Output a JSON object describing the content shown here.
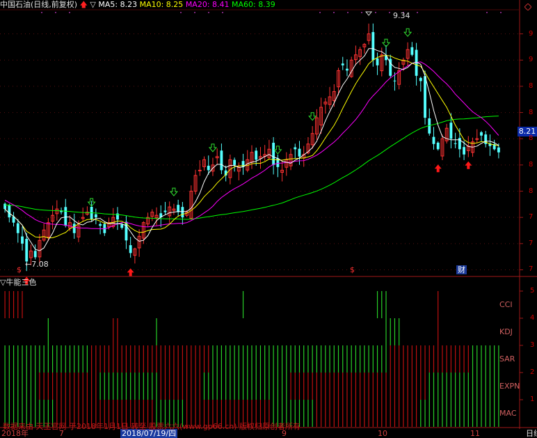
{
  "header": {
    "title": "中国石油(日线,前复权)",
    "ma5_label": "MA5: 8.23",
    "ma10_label": "MA10: 8.25",
    "ma20_label": "MA20: 8.41",
    "ma60_label": "MA60: 8.39",
    "colors": {
      "title": "#e0e0e0",
      "ma5": "#ffffff",
      "ma10": "#ffff00",
      "ma20": "#ff00ff",
      "ma60": "#00ff00"
    }
  },
  "price_panel": {
    "y_ticks": [
      "9",
      "9",
      "8",
      "8",
      "8",
      "8",
      "8",
      "7",
      "7",
      "7",
      "7"
    ],
    "current_price": "8.21",
    "high_annotation": "9.34",
    "low_annotation": "←7.08",
    "event_markers": [
      "$",
      "$",
      "财"
    ]
  },
  "indicator_panel": {
    "title": "牛能三色",
    "row_labels": [
      "CCI",
      "KDJ",
      "SAR",
      "EXPN",
      "MAC"
    ],
    "y_ticks": [
      "5",
      "4",
      "3",
      "2",
      "1"
    ]
  },
  "x_axis": {
    "labels": [
      "2018年",
      "7",
      "2018/07/19/四",
      "9",
      "10",
      "11"
    ],
    "selected_date": "2018/07/19/四",
    "watermark": "数据来由 天王官网 于2018年1月1日 转至 股票六六(www.gp66.cn) 版权归原创者所有",
    "corner_label": "日线"
  },
  "chart_data": {
    "type": "candlestick",
    "ylim": [
      6.95,
      9.48
    ],
    "y_tick_values": [
      9.25,
      9.0,
      8.75,
      8.5,
      8.25,
      8.0,
      7.75,
      7.5,
      7.25,
      7.0
    ],
    "up_color": "#ff3232",
    "down_color": "#54ffff",
    "ma_colors": {
      "ma5": "#ffffff",
      "ma10": "#ffff00",
      "ma20": "#ff00ff",
      "ma60": "#00ff00"
    },
    "closes": [
      7.58,
      7.5,
      7.45,
      7.35,
      7.25,
      7.08,
      7.18,
      7.12,
      7.28,
      7.38,
      7.45,
      7.52,
      7.58,
      7.55,
      7.42,
      7.45,
      7.35,
      7.42,
      7.5,
      7.55,
      7.48,
      7.5,
      7.42,
      7.35,
      7.45,
      7.5,
      7.48,
      7.4,
      7.28,
      7.16,
      7.2,
      7.32,
      7.45,
      7.5,
      7.55,
      7.52,
      7.5,
      7.55,
      7.6,
      7.58,
      7.55,
      7.5,
      7.55,
      7.75,
      7.9,
      7.95,
      8.05,
      7.95,
      8.0,
      8.08,
      7.95,
      7.9,
      8.05,
      8.0,
      7.98,
      7.98,
      8.05,
      8.12,
      8.05,
      8.08,
      8.1,
      8.15,
      8.0,
      7.98,
      7.95,
      8.05,
      8.1,
      8.15,
      8.08,
      8.1,
      8.2,
      8.3,
      8.45,
      8.55,
      8.6,
      8.65,
      8.7,
      8.9,
      8.95,
      8.9,
      9.0,
      9.05,
      9.1,
      9.15,
      9.25,
      9.0,
      8.95,
      9.05,
      9.0,
      8.85,
      8.8,
      8.9,
      9.0,
      9.1,
      9.05,
      8.85,
      8.8,
      8.45,
      8.3,
      8.2,
      8.15,
      8.25,
      8.35,
      8.25,
      8.2,
      8.15,
      8.1,
      8.18,
      8.22,
      8.25,
      8.28,
      8.2,
      8.18,
      8.15,
      8.12
    ],
    "bottom_rows": [
      {
        "name": "CCI",
        "segments": [
          [
            0,
            "r"
          ],
          [
            5,
            "n"
          ],
          [
            55,
            "g"
          ],
          [
            56,
            "n"
          ],
          [
            86,
            "g"
          ],
          [
            89,
            "n"
          ],
          [
            100,
            "r"
          ],
          [
            101,
            "n"
          ]
        ]
      },
      {
        "name": "KDJ",
        "segments": [
          [
            0,
            "n"
          ],
          [
            10,
            "g"
          ],
          [
            11,
            "n"
          ],
          [
            25,
            "r"
          ],
          [
            27,
            "n"
          ],
          [
            35,
            "g"
          ],
          [
            36,
            "n"
          ],
          [
            88,
            "g"
          ],
          [
            92,
            "n"
          ],
          [
            100,
            "r"
          ],
          [
            101,
            "n"
          ]
        ]
      },
      {
        "name": "SAR",
        "segments": [
          [
            0,
            "g"
          ],
          [
            20,
            "r"
          ],
          [
            48,
            "g"
          ],
          [
            89,
            "r"
          ],
          [
            108,
            "g"
          ]
        ]
      },
      {
        "name": "EXPN",
        "segments": [
          [
            0,
            "g"
          ],
          [
            8,
            "r"
          ],
          [
            22,
            "g"
          ],
          [
            36,
            "r"
          ],
          [
            46,
            "g"
          ],
          [
            66,
            "r"
          ],
          [
            98,
            "g"
          ]
        ]
      },
      {
        "name": "MAC",
        "segments": [
          [
            0,
            "g"
          ],
          [
            12,
            "r"
          ],
          [
            35,
            "g"
          ],
          [
            42,
            "r"
          ],
          [
            62,
            "g"
          ],
          [
            72,
            "r"
          ],
          [
            96,
            "g"
          ]
        ]
      }
    ],
    "marker_arrows": {
      "up_red": [
        5,
        29,
        100,
        107
      ],
      "down_green": [
        20,
        39,
        48,
        63,
        71,
        88,
        93
      ]
    }
  }
}
